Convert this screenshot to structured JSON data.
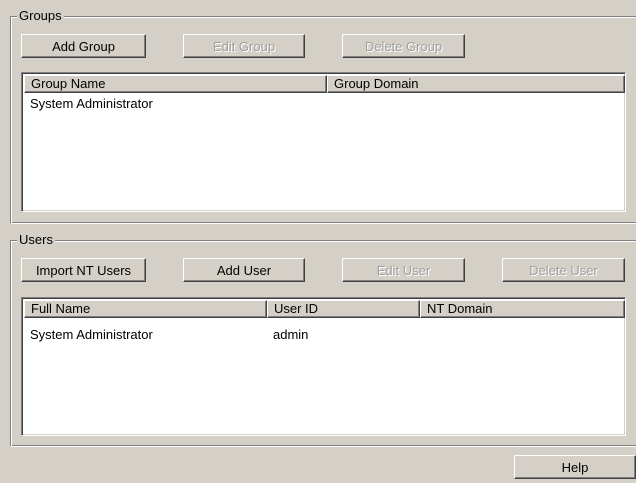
{
  "groups": {
    "title": "Groups",
    "buttons": {
      "add_group": "Add Group",
      "edit_group": "Edit Group",
      "delete_group": "Delete Group"
    },
    "columns": [
      "Group Name",
      "Group Domain"
    ],
    "rows": [
      {
        "group_name": "System Administrator",
        "group_domain": ""
      }
    ]
  },
  "users": {
    "title": "Users",
    "buttons": {
      "import_nt_users": "Import NT Users",
      "add_user": "Add User",
      "edit_user": "Edit User",
      "delete_user": "Delete User"
    },
    "columns": [
      "Full Name",
      "User ID",
      "NT Domain"
    ],
    "rows": [
      {
        "full_name": "System Administrator",
        "user_id": "admin",
        "nt_domain": ""
      }
    ]
  },
  "footer": {
    "help_label": "Help"
  }
}
